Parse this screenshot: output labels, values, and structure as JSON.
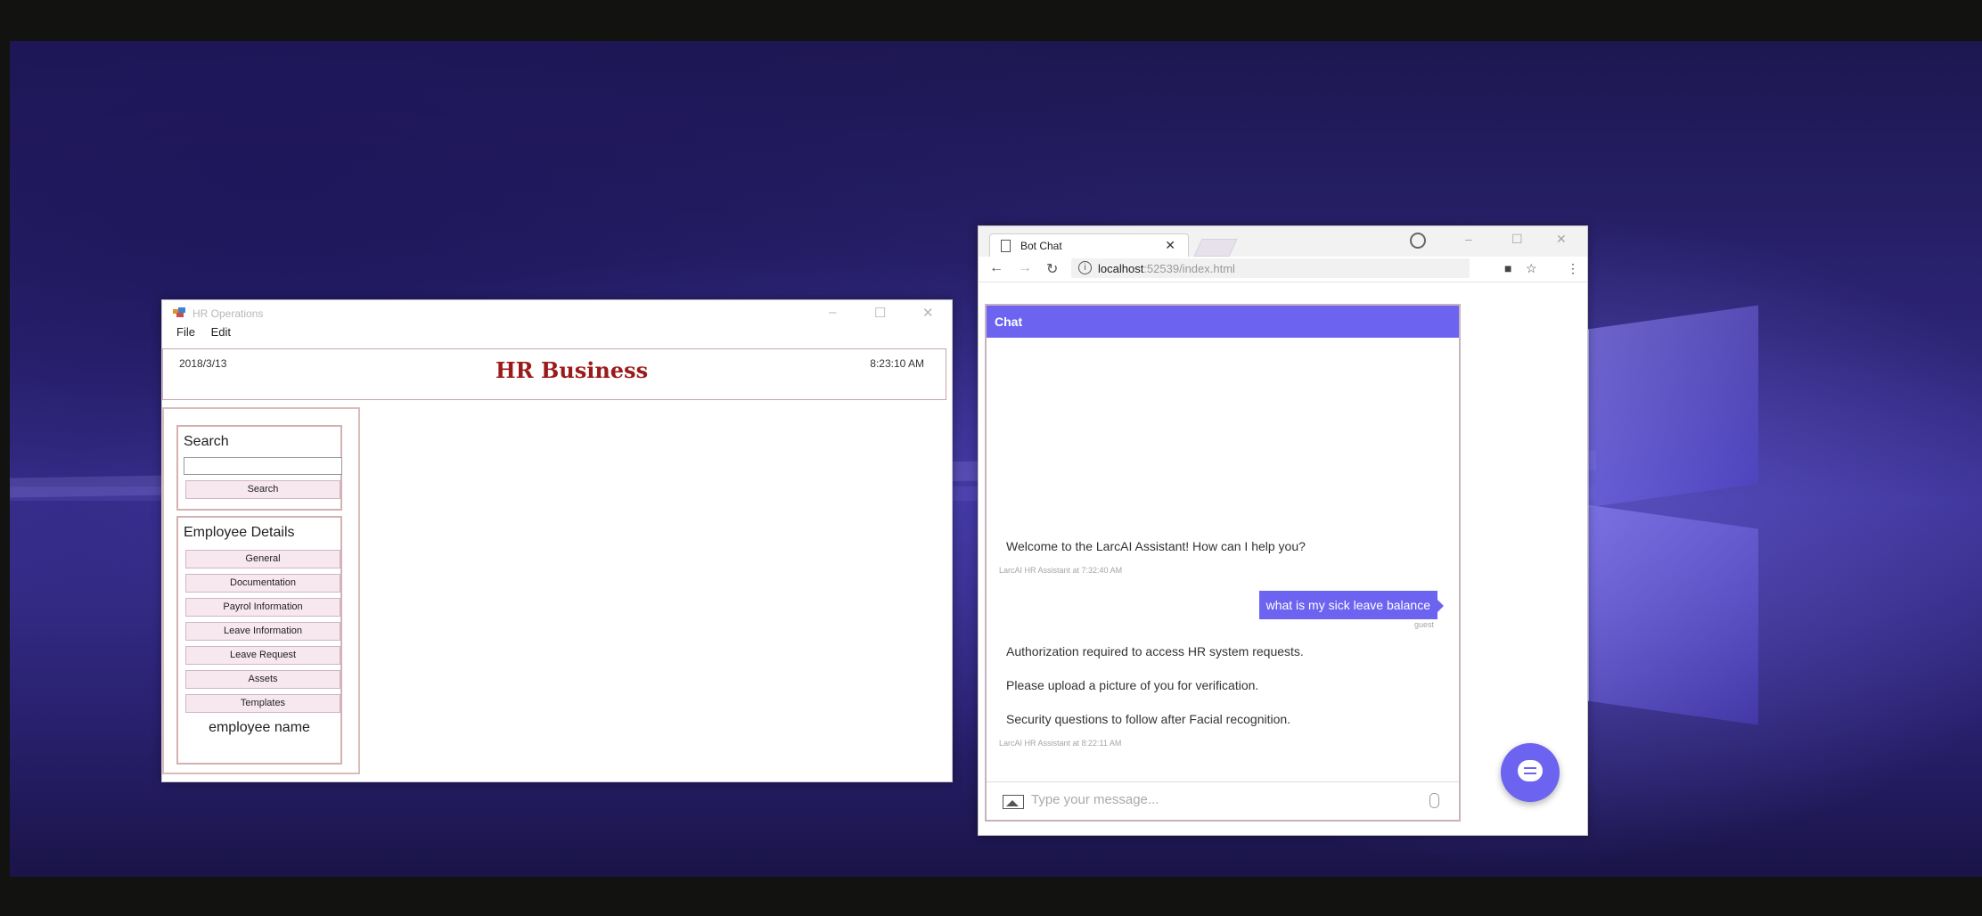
{
  "hr_window": {
    "title": "HR Operations",
    "menu": [
      "File",
      "Edit"
    ],
    "date": "2018/3/13",
    "brand": "HR Business",
    "time": "8:23:10 AM",
    "search": {
      "title": "Search",
      "input_value": "",
      "button": "Search"
    },
    "employee_details": {
      "title": "Employee Details",
      "buttons": [
        "General",
        "Documentation",
        "Payrol Information",
        "Leave Information",
        "Leave Request",
        "Assets",
        "Templates"
      ],
      "name_label": "employee name"
    }
  },
  "browser": {
    "tab_title": "Bot Chat",
    "url_host": "localhost",
    "url_rest": ":52539/index.html",
    "chat": {
      "header": "Chat",
      "messages": [
        {
          "from": "bot",
          "text": "Welcome to the LarcAI Assistant! How can I help you?"
        },
        {
          "from": "user",
          "text": "what is my sick leave balance"
        },
        {
          "from": "bot",
          "text": "Authorization required to access HR system requests."
        },
        {
          "from": "bot",
          "text": "Please upload a picture of you for verification."
        },
        {
          "from": "bot",
          "text": "Security questions to follow after Facial recognition."
        }
      ],
      "meta_1": "LarcAI HR Assistant at 7:32:40 AM",
      "meta_user": "guest",
      "meta_2": "LarcAI HR Assistant at 8:22:11 AM",
      "placeholder": "Type your message..."
    }
  },
  "colors": {
    "accent": "#6c64f0",
    "brand_red": "#9b1b1b"
  }
}
